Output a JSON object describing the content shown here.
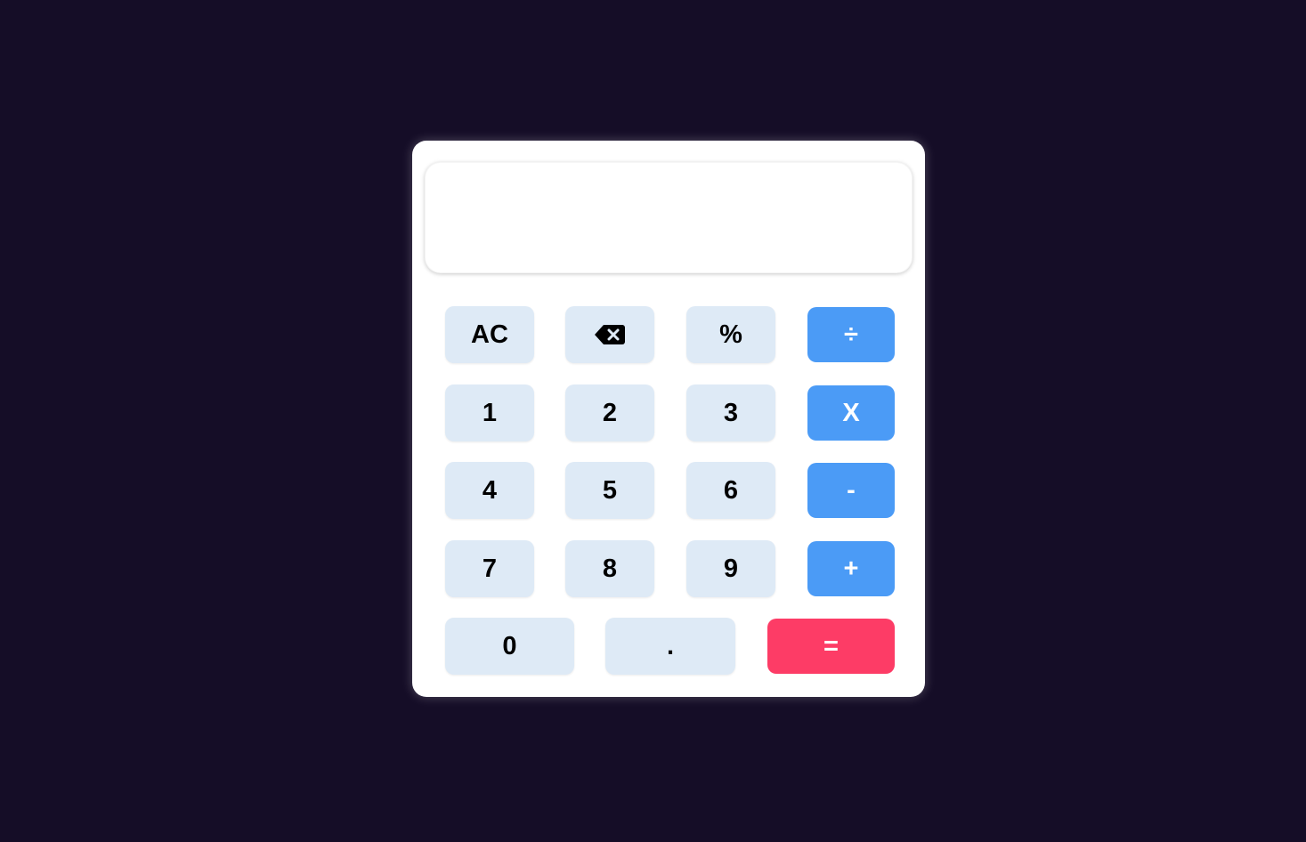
{
  "display": {
    "value": ""
  },
  "keys": {
    "clear": "AC",
    "backspace_icon": "backspace-icon",
    "percent": "%",
    "divide": "÷",
    "one": "1",
    "two": "2",
    "three": "3",
    "multiply": "X",
    "four": "4",
    "five": "5",
    "six": "6",
    "subtract": "-",
    "seven": "7",
    "eight": "8",
    "nine": "9",
    "add": "+",
    "zero": "0",
    "decimal": ".",
    "equals": "="
  },
  "colors": {
    "page_background": "#150d27",
    "calculator_background": "#ffffff",
    "key_light": "#deeaf6",
    "operator": "#4b9bf6",
    "equals": "#fd3c66"
  }
}
